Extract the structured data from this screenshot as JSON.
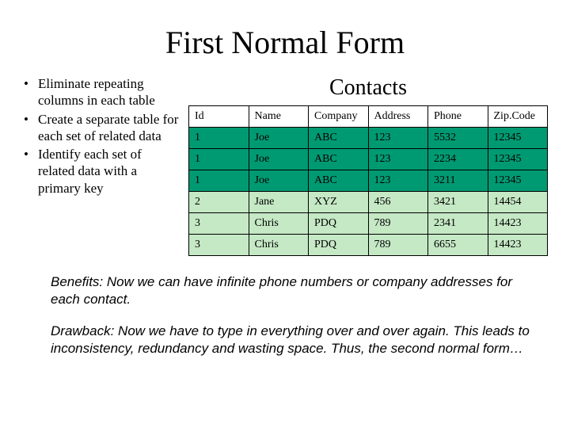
{
  "title": "First Normal Form",
  "bullets": [
    "Eliminate repeating columns in each table",
    "Create a separate table for each set of related data",
    "Identify each set of related data with a primary key"
  ],
  "table": {
    "title": "Contacts",
    "columns": [
      "Id",
      "Name",
      "Company",
      "Address",
      "Phone",
      "Zip.Code"
    ],
    "rows": [
      {
        "shade": "dark",
        "cells": [
          "1",
          "Joe",
          "ABC",
          "123",
          "5532",
          "12345"
        ]
      },
      {
        "shade": "dark",
        "cells": [
          "1",
          "Joe",
          "ABC",
          "123",
          "2234",
          "12345"
        ]
      },
      {
        "shade": "dark",
        "cells": [
          "1",
          "Joe",
          "ABC",
          "123",
          "3211",
          "12345"
        ]
      },
      {
        "shade": "light",
        "cells": [
          "2",
          "Jane",
          "XYZ",
          "456",
          "3421",
          "14454"
        ]
      },
      {
        "shade": "light",
        "cells": [
          "3",
          "Chris",
          "PDQ",
          "789",
          "2341",
          "14423"
        ]
      },
      {
        "shade": "light",
        "cells": [
          "3",
          "Chris",
          "PDQ",
          "789",
          "6655",
          "14423"
        ]
      }
    ]
  },
  "benefits_label": "Benefits:",
  "benefits_text": " Now we can have infinite phone numbers or company addresses for each contact.",
  "drawback_label": "Drawback:",
  "drawback_text": " Now we have to type in everything over and over again.  This leads to inconsistency, redundancy and wasting space.  Thus, the second normal form…",
  "chart_data": {
    "type": "table",
    "title": "Contacts",
    "columns": [
      "Id",
      "Name",
      "Company",
      "Address",
      "Phone",
      "Zip.Code"
    ],
    "rows": [
      [
        "1",
        "Joe",
        "ABC",
        "123",
        "5532",
        "12345"
      ],
      [
        "1",
        "Joe",
        "ABC",
        "123",
        "2234",
        "12345"
      ],
      [
        "1",
        "Joe",
        "ABC",
        "123",
        "3211",
        "12345"
      ],
      [
        "2",
        "Jane",
        "XYZ",
        "456",
        "3421",
        "14454"
      ],
      [
        "3",
        "Chris",
        "PDQ",
        "789",
        "2341",
        "14423"
      ],
      [
        "3",
        "Chris",
        "PDQ",
        "789",
        "6655",
        "14423"
      ]
    ]
  }
}
